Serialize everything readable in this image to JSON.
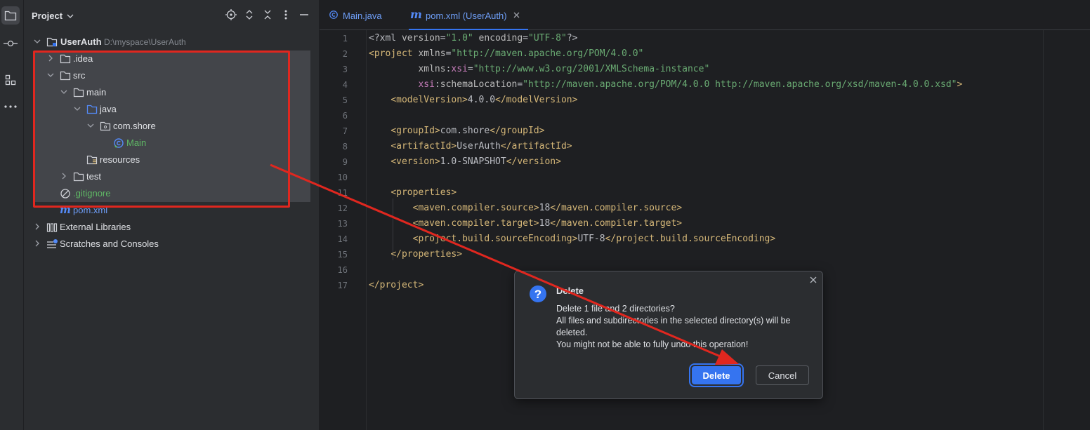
{
  "project_pane": {
    "title": "Project",
    "root": {
      "name": "UserAuth",
      "path": "D:\\myspace\\UserAuth"
    },
    "items": [
      {
        "label": ".idea"
      },
      {
        "label": "src"
      },
      {
        "label": "main"
      },
      {
        "label": "java"
      },
      {
        "label": "com.shore"
      },
      {
        "label": "Main"
      },
      {
        "label": "resources"
      },
      {
        "label": "test"
      },
      {
        "label": ".gitignore"
      },
      {
        "label": "pom.xml"
      },
      {
        "label": "External Libraries"
      },
      {
        "label": "Scratches and Consoles"
      }
    ]
  },
  "editor": {
    "tabs": [
      {
        "label": "Main.java"
      },
      {
        "label": "pom.xml (UserAuth)"
      }
    ],
    "line_numbers": [
      "1",
      "2",
      "3",
      "4",
      "5",
      "6",
      "7",
      "8",
      "9",
      "10",
      "11",
      "12",
      "13",
      "14",
      "15",
      "16",
      "17"
    ]
  },
  "dialog": {
    "title": "Delete",
    "line1": "Delete 1 file and 2 directories?",
    "line2": "All files and subdirectories in the selected directory(s) will be",
    "line3": "deleted.",
    "line4": "You might not be able to fully undo this operation!",
    "delete_label": "Delete",
    "cancel_label": "Cancel"
  },
  "colors": {
    "accent": "#3574f0",
    "annotation_red": "#e0271f",
    "gitignore_green": "#5fb865"
  }
}
